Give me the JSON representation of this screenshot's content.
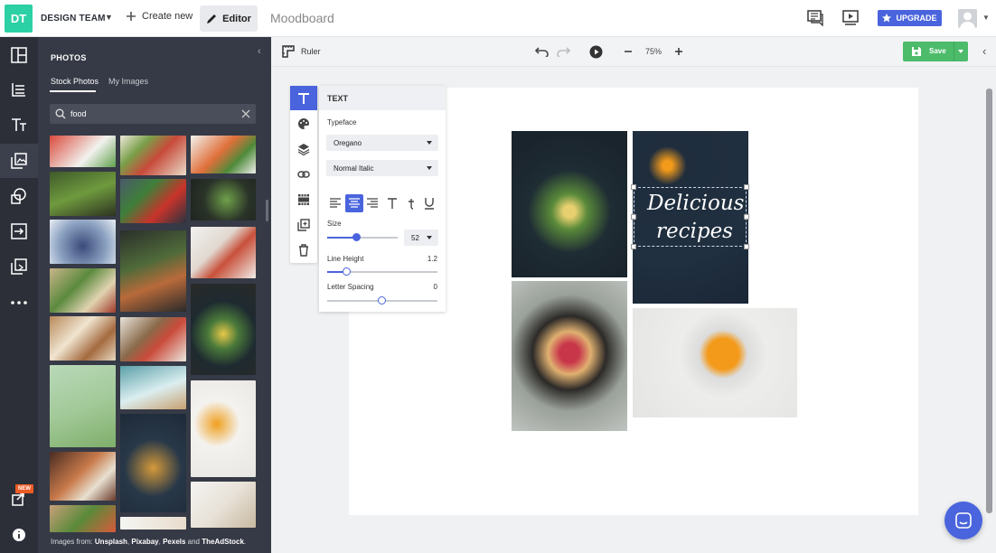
{
  "topbar": {
    "logo_text": "DT",
    "team_name": "DESIGN TEAM",
    "create_new": "Create new",
    "editor": "Editor",
    "document_title": "Moodboard",
    "upgrade": "UPGRADE"
  },
  "sidebar": {
    "items": [
      {
        "icon": "layout-icon"
      },
      {
        "icon": "list-icon"
      },
      {
        "icon": "text-icon"
      },
      {
        "icon": "photos-icon"
      },
      {
        "icon": "shapes-icon"
      },
      {
        "icon": "upload-icon"
      },
      {
        "icon": "duplicate-icon"
      },
      {
        "icon": "more-icon"
      }
    ],
    "new_badge": "NEW"
  },
  "photos_panel": {
    "title": "PHOTOS",
    "tabs": [
      "Stock Photos",
      "My Images"
    ],
    "search_value": "food",
    "footer_prefix": "Images from: ",
    "footer_sources": [
      "Unsplash",
      "Pixabay",
      "Pexels",
      "TheAdStock"
    ],
    "footer_and": " and "
  },
  "toolbar": {
    "ruler": "Ruler",
    "zoom": "75%",
    "save": "Save"
  },
  "text_panel": {
    "title": "TEXT",
    "typeface_label": "Typeface",
    "font": "Oregano",
    "style": "Normal Italic",
    "size_label": "Size",
    "size_value": "52",
    "line_height_label": "Line Height",
    "line_height_value": "1.2",
    "letter_spacing_label": "Letter Spacing",
    "letter_spacing_value": "0"
  },
  "canvas": {
    "headline_line1": "Delicious",
    "headline_line2": "recipes"
  },
  "colors": {
    "accent": "#4a64dd",
    "logo": "#2bd0a5",
    "save": "#4cbb6a",
    "sidebar_dark": "#2c2f38",
    "panel_dark": "#363a46"
  }
}
